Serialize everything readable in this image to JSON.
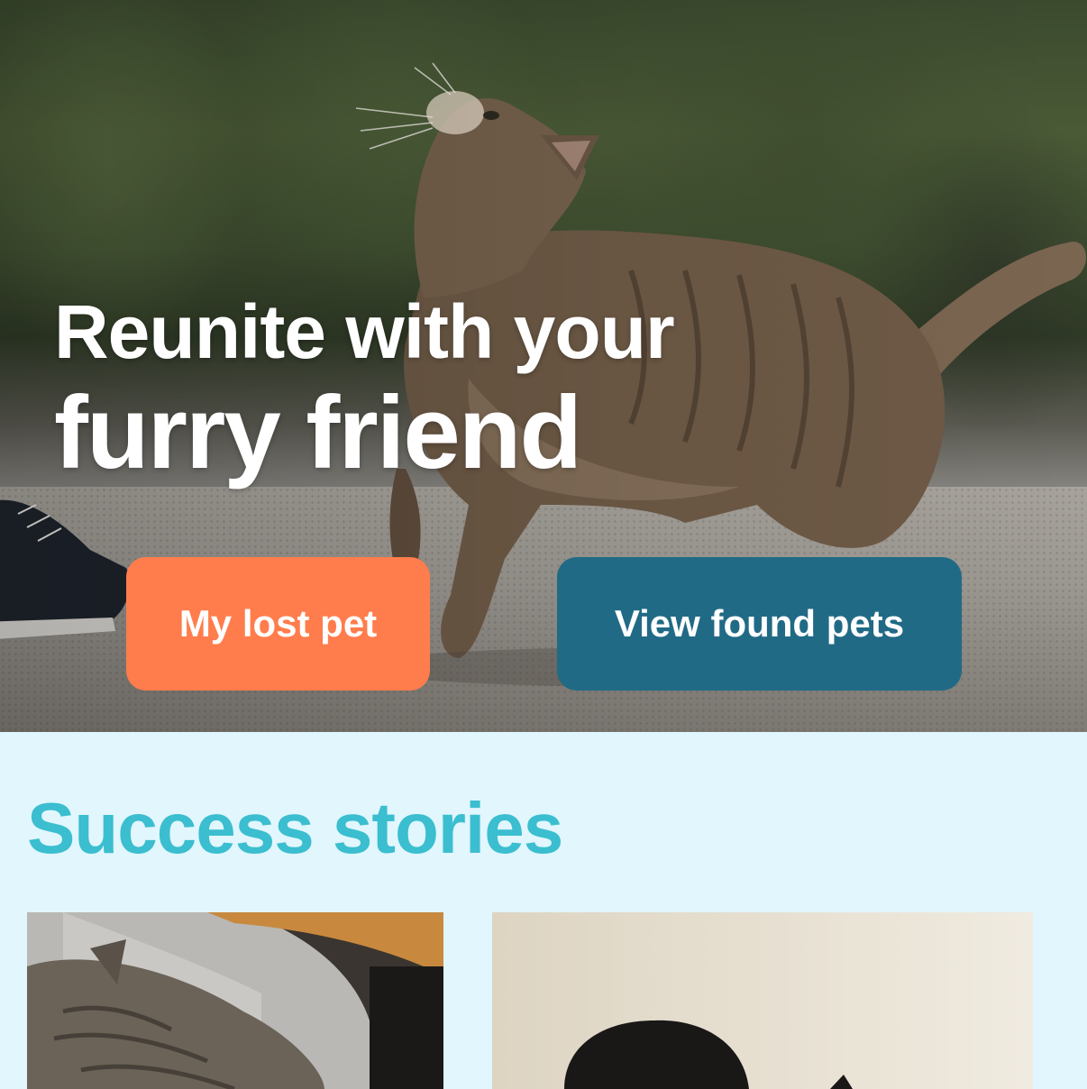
{
  "hero": {
    "title_line1": "Reunite with your",
    "title_line2": "furry friend",
    "image_icon": "cat-photo"
  },
  "actions": {
    "lost_pet_label": "My lost pet",
    "found_pets_label": "View found pets"
  },
  "stories": {
    "title": "Success stories",
    "cards": [
      {
        "image_icon": "tabby-cat-sleeping-photo"
      },
      {
        "image_icon": "person-with-cat-photo"
      }
    ]
  },
  "colors": {
    "lost_button": "#ff7d4c",
    "found_button": "#216a86",
    "stories_title": "#3bbecf",
    "stories_background": "#e1f6fd"
  }
}
